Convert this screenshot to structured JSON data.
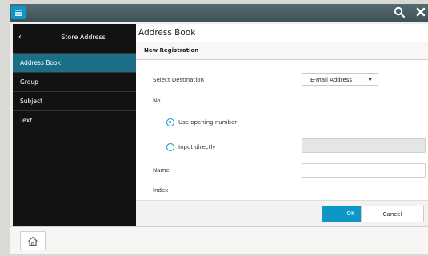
{
  "sidebar": {
    "back_glyph": "‹",
    "title": "Store Address",
    "items": [
      {
        "label": "Address Book",
        "active": true
      },
      {
        "label": "Group",
        "active": false
      },
      {
        "label": "Subject",
        "active": false
      },
      {
        "label": "Text",
        "active": false
      }
    ]
  },
  "main": {
    "title": "Address Book",
    "section_title": "New Registration",
    "select_destination_label": "Select Destination",
    "destination_value": "E-mail Address",
    "number_label": "No.",
    "radio_use_opening": "Use opening number",
    "radio_input_directly": "Input directly",
    "name_label": "Name",
    "index_label": "Index",
    "name_value": "",
    "number_value": ""
  },
  "buttons": {
    "ok": "OK",
    "cancel": "Cancel"
  },
  "icons": {
    "menu": "menu-icon",
    "search": "search-icon",
    "close": "close-icon",
    "home": "home-icon",
    "dropdown": "caret-down-icon"
  },
  "colors": {
    "accent": "#0d97c8",
    "sidebar_active": "#1a6f86",
    "sidebar_bg": "#121212",
    "topbar": "#4a5e62"
  }
}
